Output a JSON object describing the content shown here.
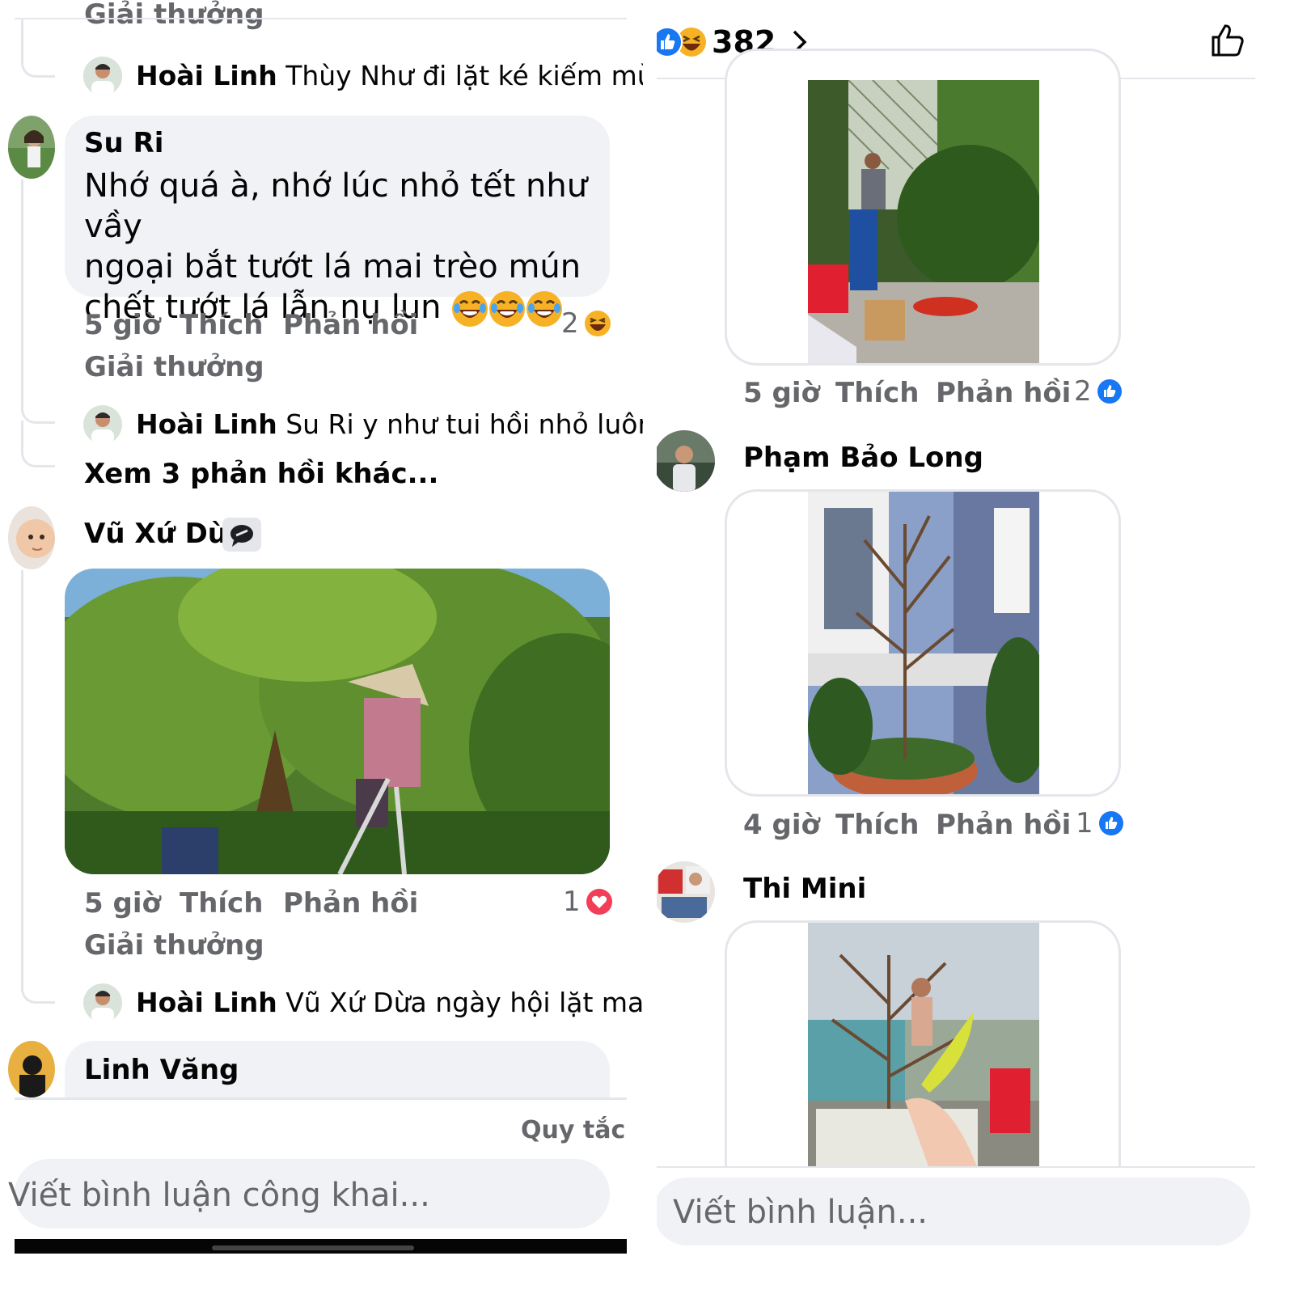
{
  "left": {
    "top_clipped_label": "Giải thưởng",
    "reply1": {
      "name": "Hoài Linh",
      "text": "Thùy Như đi lặt ké kiếm mù..."
    },
    "comment_suri": {
      "name": "Su Ri",
      "lines": [
        "Nhớ quá à, nhớ lúc nhỏ tết như vầy",
        "ngoại bắt tướt lá mai trèo mún",
        "chết tướt lá lẫn nụ lun"
      ],
      "time": "5 giờ",
      "like": "Thích",
      "reply": "Phản hồi",
      "award": "Giải thưởng",
      "reaction_count": "2",
      "reaction_icon": "haha-icon"
    },
    "reply2": {
      "name": "Hoài Linh",
      "text": "Su Ri y như tui hồi nhỏ luôn..."
    },
    "see_more": "Xem 3 phản hồi khác...",
    "comment_vu": {
      "name": "Vũ Xứ Dừa",
      "badge_icon": "chat-bubble-icon",
      "time": "5 giờ",
      "like": "Thích",
      "reply": "Phản hồi",
      "award": "Giải thưởng",
      "reaction_count": "1",
      "reaction_icon": "love-icon"
    },
    "reply3": {
      "name": "Hoài Linh",
      "text": "Vũ Xứ Dừa ngày hội lặt mai ..."
    },
    "comment_linh": {
      "name": "Linh Văng"
    },
    "rules": "Quy tắc",
    "input_placeholder": "Viết bình luận công khai..."
  },
  "right": {
    "reaction_total": "382",
    "reaction_icons": [
      "like-icon",
      "haha-icon"
    ],
    "comment1": {
      "time": "5 giờ",
      "like": "Thích",
      "reply": "Phản hồi",
      "reaction_count": "2",
      "reaction_icon": "like-icon"
    },
    "comment2": {
      "name": "Phạm Bảo Long",
      "time": "4 giờ",
      "like": "Thích",
      "reply": "Phản hồi",
      "reaction_count": "1",
      "reaction_icon": "like-icon"
    },
    "comment3": {
      "name": "Thi Mini"
    },
    "input_placeholder": "Viết bình luận..."
  },
  "colors": {
    "bubble": "#f0f2f5",
    "meta": "#65676b",
    "like_blue": "#1877f2",
    "love_red": "#f33e58",
    "haha_yellow": "#f7b125"
  }
}
